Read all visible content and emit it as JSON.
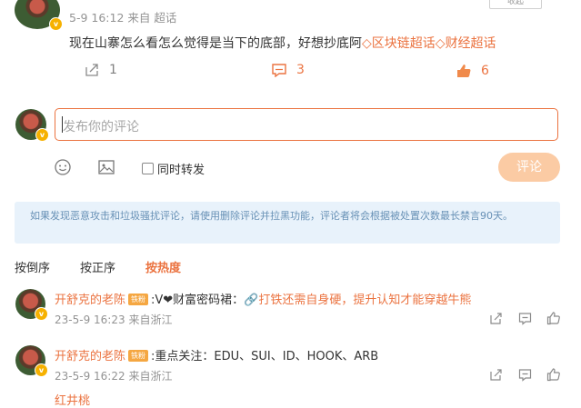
{
  "top_post": {
    "button_label": "收起",
    "time": "5-9 16:12",
    "source": "来自",
    "source_link": "超话",
    "text": "现在山寨怎么看怎么觉得是当下的底部，好想抄底阿",
    "topic_1": "区块链超话",
    "topic_2": "财经超话",
    "repost_count": "1",
    "comment_count": "3",
    "like_count": "6"
  },
  "composer": {
    "placeholder": "发布你的评论",
    "also_repost": "同时转发",
    "submit": "评论"
  },
  "notice": "如果发现恶意攻击和垃圾骚扰评论，请使用删除评论并拉黑功能，评论者将会根据被处置次数最长禁言90天。",
  "sort": {
    "tabs": [
      "按倒序",
      "按正序",
      "按热度"
    ],
    "active_index": 2
  },
  "comments": [
    {
      "user": "开舒克的老陈",
      "badge": "铁粉",
      "text_prefix": ":V❤财富密码裙：",
      "link_text": "打铁还需自身硬，提升认知才能穿越牛熊",
      "time": "23-5-9 16:23",
      "location": "来自浙江"
    },
    {
      "user": "开舒克的老陈",
      "badge": "铁粉",
      "text_prefix": ":重点关注：EDU、SUI、ID、HOOK、ARB",
      "link_text": "",
      "time": "23-5-9 16:22",
      "location": "来自浙江"
    },
    {
      "user": "红井桃",
      "badge": "",
      "text_prefix": "",
      "link_text": "",
      "time": "",
      "location": ""
    }
  ],
  "colors": {
    "accent": "#eb7340",
    "notice_bg": "#e8f2fb",
    "notice_text": "#6891b6",
    "submit_bg": "#fbcba4"
  }
}
